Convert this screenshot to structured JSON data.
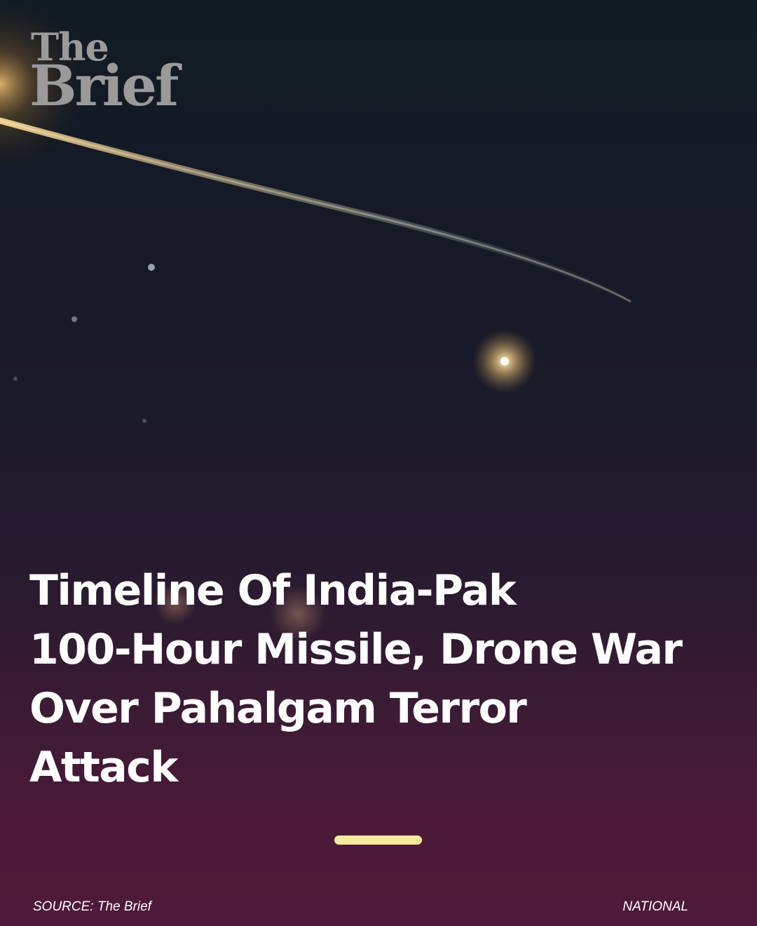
{
  "brand": {
    "logo_line1": "The",
    "logo_line2": "Brief",
    "logo_color": "#9a9a9a"
  },
  "headline": {
    "lines": [
      "Timeline Of India-Pak",
      "100-Hour Missile, Drone War",
      "Over Pahalgam Terror",
      "Attack"
    ],
    "color": "#ffffff"
  },
  "background": {
    "description_icon": "night-sky-missile-photo",
    "gradient_top": "#121b24",
    "gradient_bottom": "#4f1a39"
  },
  "swipe_indicator": {
    "color": "#f4eaa0"
  },
  "footer": {
    "source": "SOURCE: The Brief",
    "category": "NATIONAL"
  }
}
